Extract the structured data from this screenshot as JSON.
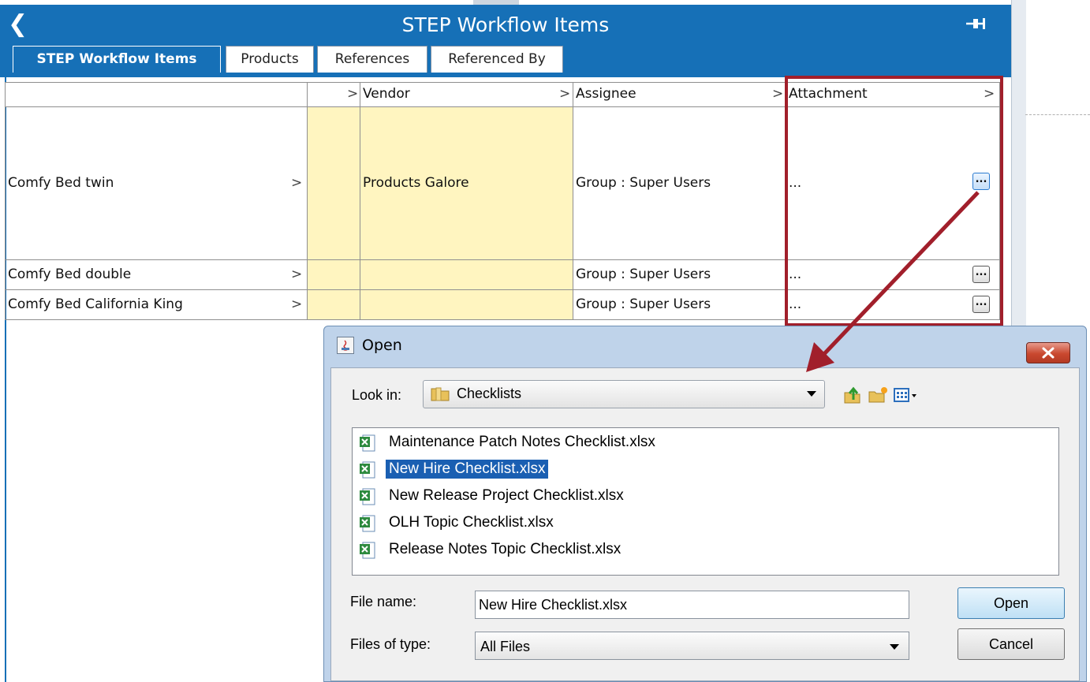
{
  "window": {
    "title": "STEP Workflow Items"
  },
  "tabs": [
    {
      "label": "STEP Workflow Items",
      "active": true
    },
    {
      "label": "Products"
    },
    {
      "label": "References"
    },
    {
      "label": "Referenced By"
    }
  ],
  "grid": {
    "headers": [
      "",
      "",
      "Vendor",
      "Assignee",
      "Attachment"
    ],
    "rows": [
      {
        "name": "Comfy Bed twin",
        "vendor": "Products Galore",
        "assignee": "Group : Super Users",
        "attachment": "..."
      },
      {
        "name": "Comfy Bed double",
        "vendor": "",
        "assignee": "Group : Super Users",
        "attachment": "..."
      },
      {
        "name": "Comfy Bed California King",
        "vendor": "",
        "assignee": "Group : Super Users",
        "attachment": "..."
      }
    ],
    "chevron": ">",
    "button_label": "..."
  },
  "dialog": {
    "title": "Open",
    "look_in_label": "Look in:",
    "look_in_value": "Checklists",
    "files": [
      {
        "name": "Maintenance Patch Notes Checklist.xlsx",
        "selected": false
      },
      {
        "name": "New Hire Checklist.xlsx",
        "selected": true
      },
      {
        "name": "New Release Project Checklist.xlsx",
        "selected": false
      },
      {
        "name": "OLH Topic Checklist.xlsx",
        "selected": false
      },
      {
        "name": "Release Notes Topic Checklist.xlsx",
        "selected": false
      }
    ],
    "file_name_label": "File name:",
    "file_name_value": "New Hire Checklist.xlsx",
    "files_of_type_label": "Files of type:",
    "files_of_type_value": "All Files",
    "open_button": "Open",
    "cancel_button": "Cancel"
  },
  "colors": {
    "title_bar": "#1670b7",
    "highlight": "#a11f2b",
    "yellow_cell": "#fff5c0",
    "selection": "#1a5fb2"
  },
  "icons": [
    "back-icon",
    "pin-icon",
    "close-icon",
    "folder-icon",
    "up-folder-icon",
    "new-folder-icon",
    "view-menu-icon",
    "excel-file-icon"
  ]
}
